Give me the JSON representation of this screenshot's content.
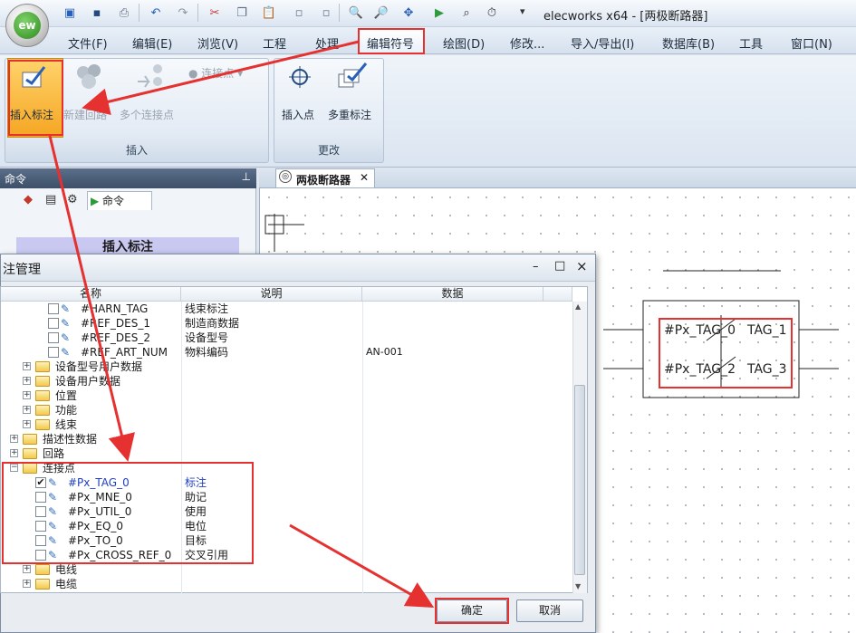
{
  "app": {
    "title": "elecworks x64 - [两极断路器]",
    "orb_label": "ew"
  },
  "menu": {
    "tabs": [
      "文件(F)",
      "编辑(E)",
      "浏览(V)",
      "工程",
      "处理",
      "编辑符号",
      "绘图(D)",
      "修改...",
      "导入/导出(I)",
      "数据库(B)",
      "工具",
      "窗口(N)"
    ]
  },
  "ribbon": {
    "insert_group_label": "插入",
    "modify_group_label": "更改",
    "buttons": {
      "insert_tag": "插入标注",
      "new_circuit": "新建回路",
      "multi_connection": "多个连接点",
      "connection_point": "连接点",
      "insert_point": "插入点",
      "multi_tag": "多重标注"
    }
  },
  "command_panel": {
    "header": "命令",
    "tab_label": "命令",
    "title": "插入标注"
  },
  "document": {
    "tab_label": "两极断路器",
    "tags": [
      "#Px_TAG_0",
      "TAG_1",
      "#Px_TAG_2",
      "TAG_3"
    ]
  },
  "dialog": {
    "title": "注管理",
    "columns": [
      "名称",
      "说明",
      "数据"
    ],
    "rows": [
      {
        "name": "#HARN_TAG",
        "desc": "线束标注",
        "data": "",
        "kind": "tag",
        "indent": 2
      },
      {
        "name": "#REF_DES_1",
        "desc": "制造商数据",
        "data": "",
        "kind": "tag",
        "indent": 2
      },
      {
        "name": "#REF_DES_2",
        "desc": "设备型号",
        "data": "",
        "kind": "tag",
        "indent": 2
      },
      {
        "name": "#REF_ART_NUM",
        "desc": "物料编码",
        "data": "AN-001",
        "kind": "tag",
        "indent": 2
      },
      {
        "name": "设备型号用户数据",
        "desc": "",
        "data": "",
        "kind": "folder",
        "indent": 1
      },
      {
        "name": "设备用户数据",
        "desc": "",
        "data": "",
        "kind": "folder",
        "indent": 1
      },
      {
        "name": "位置",
        "desc": "",
        "data": "",
        "kind": "folder",
        "indent": 1
      },
      {
        "name": "功能",
        "desc": "",
        "data": "",
        "kind": "folder",
        "indent": 1
      },
      {
        "name": "线束",
        "desc": "",
        "data": "",
        "kind": "folder",
        "indent": 1
      },
      {
        "name": "描述性数据",
        "desc": "",
        "data": "",
        "kind": "folder",
        "indent": 0
      },
      {
        "name": "回路",
        "desc": "",
        "data": "",
        "kind": "folder",
        "indent": 0
      },
      {
        "name": "连接点",
        "desc": "",
        "data": "",
        "kind": "folder-open",
        "indent": 0
      },
      {
        "name": "#Px_TAG_0",
        "desc": "标注",
        "data": "",
        "kind": "tag",
        "indent": 1,
        "checked": true,
        "highlight": true
      },
      {
        "name": "#Px_MNE_0",
        "desc": "助记",
        "data": "",
        "kind": "tag",
        "indent": 1
      },
      {
        "name": "#Px_UTIL_0",
        "desc": "使用",
        "data": "",
        "kind": "tag",
        "indent": 1
      },
      {
        "name": "#Px_EQ_0",
        "desc": "电位",
        "data": "",
        "kind": "tag",
        "indent": 1
      },
      {
        "name": "#Px_TO_0",
        "desc": "目标",
        "data": "",
        "kind": "tag",
        "indent": 1
      },
      {
        "name": "#Px_CROSS_REF_0",
        "desc": "交叉引用",
        "data": "",
        "kind": "tag",
        "indent": 1
      },
      {
        "name": "电线",
        "desc": "",
        "data": "",
        "kind": "folder",
        "indent": 1
      },
      {
        "name": "电缆",
        "desc": "",
        "data": "",
        "kind": "folder",
        "indent": 1
      }
    ],
    "ok_label": "确定",
    "cancel_label": "取消",
    "minimize": "–",
    "maximize": "□",
    "close": "×"
  },
  "colors": {
    "annotation_red": "#e5312f",
    "highlight_orange": "#f5a623",
    "tag_blue": "#1f3fbf"
  },
  "icons": [
    "undo-icon",
    "redo-icon",
    "cut-icon",
    "copy-icon",
    "paste-icon",
    "zoom-icon",
    "pan-icon",
    "close-icon"
  ]
}
